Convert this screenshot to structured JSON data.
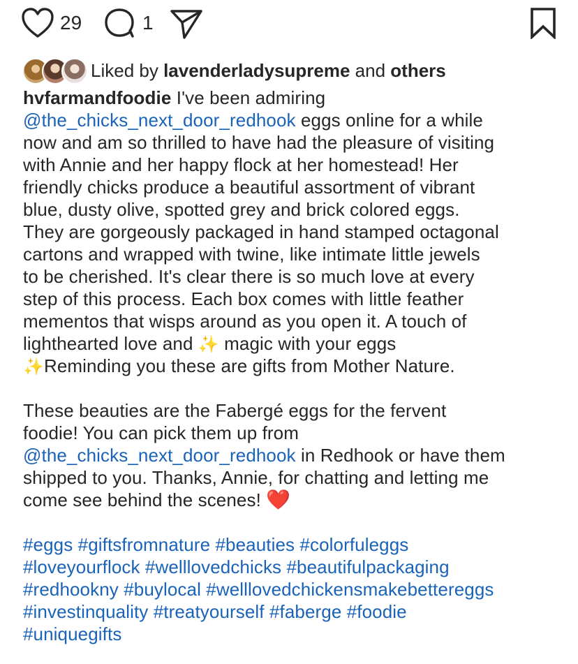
{
  "actions": {
    "like_count": "29",
    "comment_count": "1",
    "icons": [
      "heart-outline-icon",
      "comment-icon",
      "share-icon",
      "bookmark-icon"
    ]
  },
  "liked_by": {
    "prefix": "Liked by",
    "user": "lavenderladysupreme",
    "middle": "and",
    "others": "others"
  },
  "caption": {
    "username": "hvfarmandfoodie",
    "p1": {
      "l1": " I've been admiring",
      "l2_mention": "@the_chicks_next_door_redhook",
      "l2_rest": " eggs online for a while",
      "l3": "now and am so thrilled to have had the pleasure of visiting",
      "l4": "with Annie and her happy flock at her homestead! Her",
      "l5": "friendly chicks produce a beautiful assortment of vibrant",
      "l6": "blue, dusty olive, spotted grey and brick colored eggs.",
      "l7": "They are gorgeously packaged in hand stamped octagonal",
      "l8": "cartons and wrapped with twine, like intimate little jewels",
      "l9": "to be cherished. It's clear there is so much love at every",
      "l10": "step of this process. Each box comes with little feather",
      "l11": "mementos that wisps around as you open it. A touch of",
      "l12_a": "lighthearted love and ",
      "l12_b": " magic with your eggs",
      "l13_b": "Reminding you these are gifts from Mother Nature.",
      "sparkle": "✨"
    },
    "p2": {
      "l1": "These beauties are the Fabergé eggs for the fervent",
      "l2": "foodie! You can pick them up from",
      "l3_mention": "@the_chicks_next_door_redhook",
      "l3_rest": " in Redhook or have them",
      "l4": "shipped to you. Thanks, Annie, for chatting and letting me",
      "l5": "come see behind the scenes! ",
      "heart": "❤️"
    },
    "hashtags": [
      "#eggs #giftsfromnature #beauties #colorfuleggs",
      "#loveyourflock #welllovedchicks #beautifulpackaging",
      "#redhookny #buylocal #welllovedchickensmakebettereggs",
      "#investinquality #treatyourself #faberge #foodie",
      "#uniquegifts"
    ]
  },
  "colors": {
    "text": "#262626",
    "link": "#1a63b8",
    "heart_emoji": "#e0142b",
    "background": "#ffffff"
  }
}
